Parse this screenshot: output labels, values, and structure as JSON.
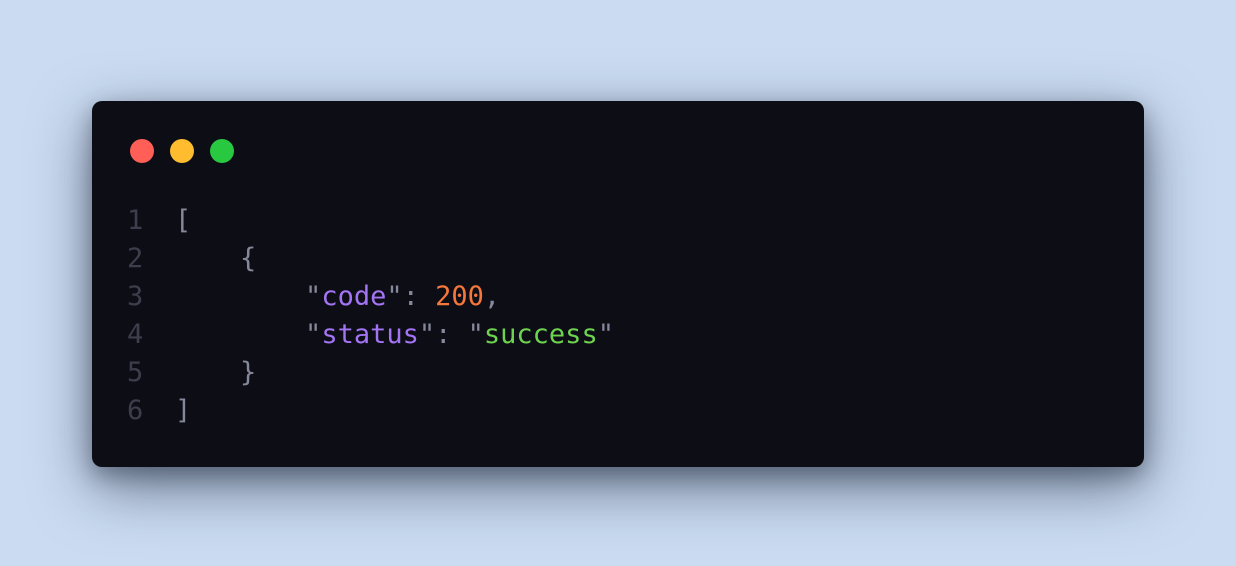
{
  "colors": {
    "background": "#cbdcf2",
    "window": "#0c0d15",
    "close": "#ff5f57",
    "minimize": "#febc2e",
    "maximize": "#28c840",
    "punctuation": "#85889a",
    "key": "#a374f3",
    "number": "#f4773c",
    "string": "#6ed34f",
    "line_number": "#3c3e4c"
  },
  "window_controls": [
    "close-icon",
    "minimize-icon",
    "maximize-icon"
  ],
  "code": {
    "lines": [
      {
        "number": "1",
        "indent": "",
        "tokens": [
          {
            "t": "[",
            "k": "punct"
          }
        ]
      },
      {
        "number": "2",
        "indent": "    ",
        "tokens": [
          {
            "t": "{",
            "k": "punct"
          }
        ]
      },
      {
        "number": "3",
        "indent": "        ",
        "tokens": [
          {
            "t": "\"",
            "k": "punct"
          },
          {
            "t": "code",
            "k": "key"
          },
          {
            "t": "\"",
            "k": "punct"
          },
          {
            "t": ": ",
            "k": "punct"
          },
          {
            "t": "200",
            "k": "number"
          },
          {
            "t": ",",
            "k": "punct"
          }
        ]
      },
      {
        "number": "4",
        "indent": "        ",
        "tokens": [
          {
            "t": "\"",
            "k": "punct"
          },
          {
            "t": "status",
            "k": "key"
          },
          {
            "t": "\"",
            "k": "punct"
          },
          {
            "t": ": ",
            "k": "punct"
          },
          {
            "t": "\"",
            "k": "punct"
          },
          {
            "t": "success",
            "k": "string"
          },
          {
            "t": "\"",
            "k": "punct"
          }
        ]
      },
      {
        "number": "5",
        "indent": "    ",
        "tokens": [
          {
            "t": "}",
            "k": "punct"
          }
        ]
      },
      {
        "number": "6",
        "indent": "",
        "tokens": [
          {
            "t": "]",
            "k": "punct"
          }
        ]
      }
    ]
  }
}
